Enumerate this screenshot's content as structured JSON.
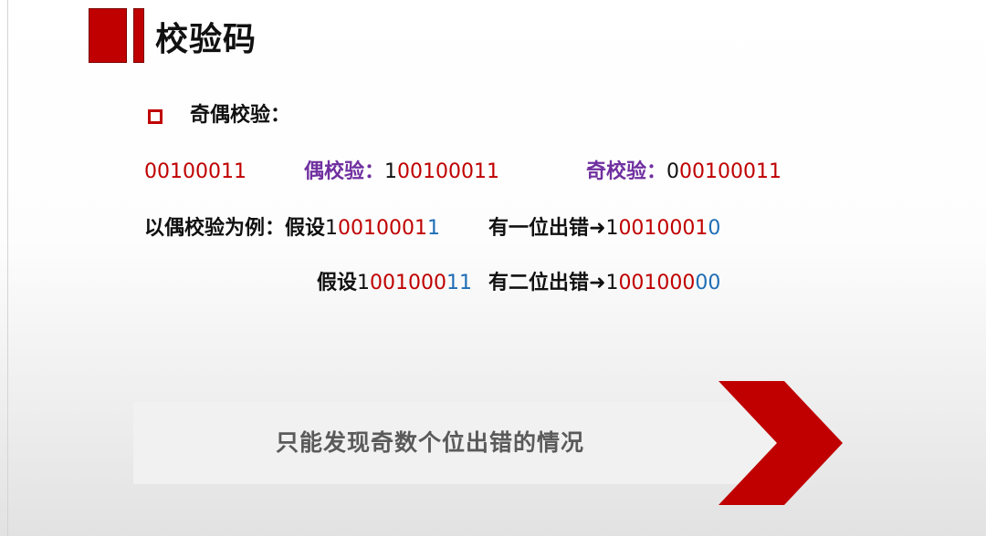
{
  "title": "校验码",
  "section_heading": "奇偶校验：",
  "row1": {
    "original": "00100011",
    "even_label": "偶校验：",
    "even_parity_bit": "1",
    "even_data": "00100011",
    "odd_label": "奇校验：",
    "odd_parity_bit": "0",
    "odd_data": "00100011"
  },
  "row2": {
    "prefix": "以偶校验为例：假设",
    "code_head": "1",
    "code_mid": "0010001",
    "code_tail": "1",
    "result_text": "有一位出错➜",
    "result_head": "1",
    "result_mid": "0010001",
    "result_tail": "0"
  },
  "row3": {
    "prefix": "假设",
    "code_head": "1",
    "code_mid": "001000",
    "code_tail": "11",
    "result_text": "有二位出错➜",
    "result_head": "1",
    "result_mid": "001000",
    "result_tail": "00"
  },
  "callout": "只能发现奇数个位出错的情况",
  "colors": {
    "accent_red": "#c00000",
    "blue": "#1f6db5",
    "purple": "#7030a0"
  }
}
